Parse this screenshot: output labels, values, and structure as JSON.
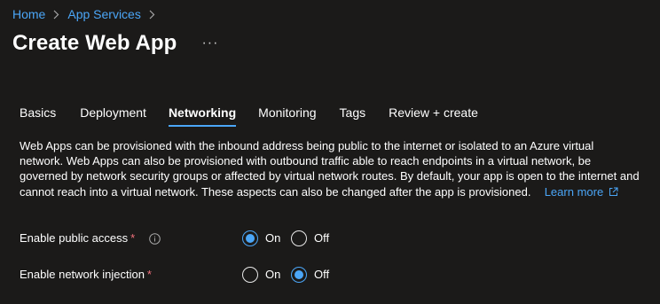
{
  "breadcrumb": {
    "items": [
      {
        "label": "Home"
      },
      {
        "label": "App Services"
      }
    ]
  },
  "page": {
    "title": "Create Web App",
    "more_label": "···"
  },
  "tabs": [
    {
      "label": "Basics",
      "active": false
    },
    {
      "label": "Deployment",
      "active": false
    },
    {
      "label": "Networking",
      "active": true
    },
    {
      "label": "Monitoring",
      "active": false
    },
    {
      "label": "Tags",
      "active": false
    },
    {
      "label": "Review + create",
      "active": false
    }
  ],
  "description": {
    "text": "Web Apps can be provisioned with the inbound address being public to the internet or isolated to an Azure virtual network. Web Apps can also be provisioned with outbound traffic able to reach endpoints in a virtual network, be governed by network security groups or affected by virtual network routes. By default, your app is open to the internet and cannot reach into a virtual network. These aspects can also be changed after the app is provisioned.",
    "learn_more": "Learn more"
  },
  "fields": {
    "public_access": {
      "label": "Enable public access",
      "required_marker": "*",
      "options": [
        {
          "label": "On",
          "checked": true
        },
        {
          "label": "Off",
          "checked": false
        }
      ]
    },
    "network_injection": {
      "label": "Enable network injection",
      "required_marker": "*",
      "options": [
        {
          "label": "On",
          "checked": false
        },
        {
          "label": "Off",
          "checked": true
        }
      ]
    }
  },
  "colors": {
    "background": "#1b1a19",
    "link": "#4ba6f7",
    "accent": "#4ba6f7",
    "required": "#f1707b"
  },
  "icons": [
    "chevron-right-icon",
    "more-icon",
    "info-icon",
    "external-link-icon"
  ]
}
